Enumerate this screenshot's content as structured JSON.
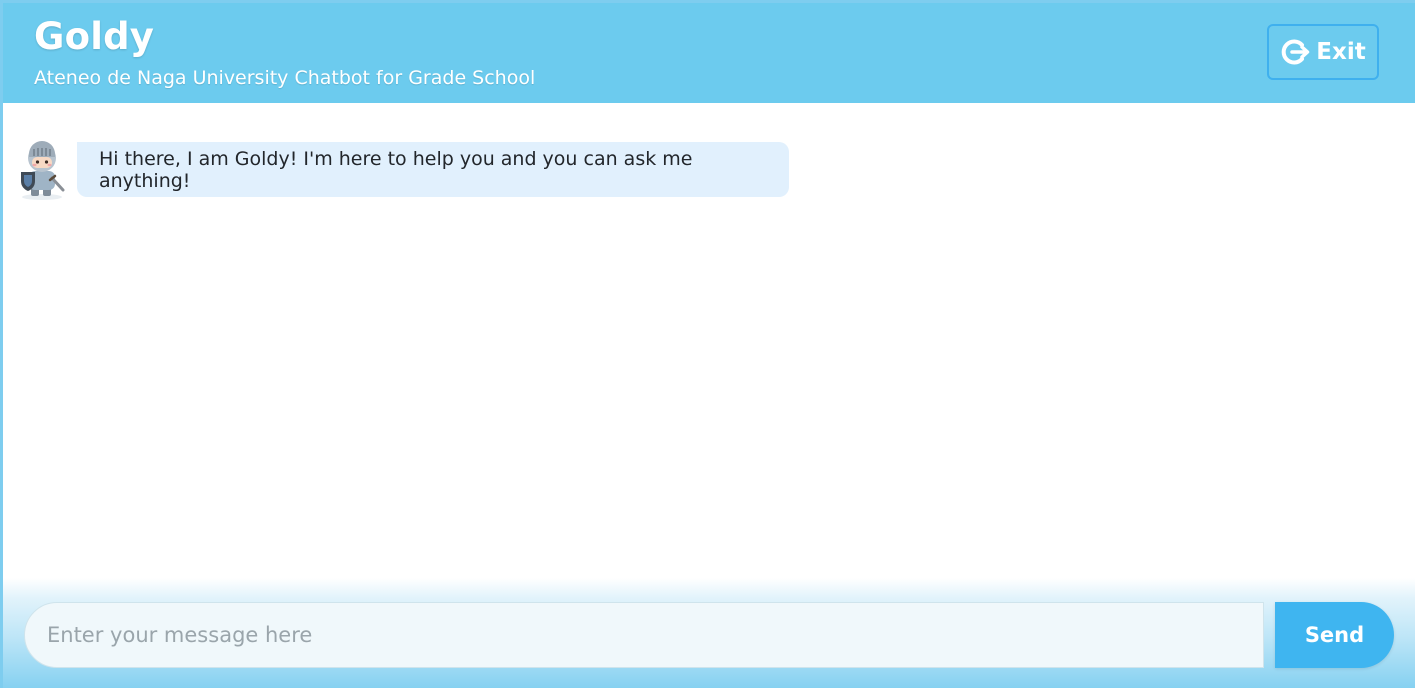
{
  "header": {
    "title": "Goldy",
    "subtitle": "Ateneo de Naga University Chatbot for Grade School",
    "exit_label": "Exit",
    "exit_icon": "logout-icon"
  },
  "chat": {
    "messages": [
      {
        "sender": "bot",
        "avatar_icon": "knight-avatar-icon",
        "text": "Hi there, I am Goldy! I'm here to help you and you can ask me anything!"
      }
    ]
  },
  "composer": {
    "placeholder": "Enter your message here",
    "value": "",
    "send_label": "Send"
  },
  "colors": {
    "header_bg": "#6ccbee",
    "bubble_bg": "#e1f0fd",
    "send_bg": "#3fb5f0",
    "exit_border": "#3fb0ee"
  }
}
